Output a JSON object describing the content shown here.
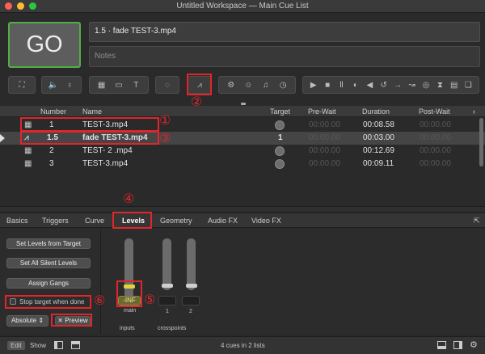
{
  "window": {
    "title": "Untitled Workspace — Main Cue List",
    "colors": {
      "close": "#ff5f57",
      "min": "#febc2e",
      "max": "#28c840"
    }
  },
  "go": {
    "label": "GO"
  },
  "cue_name": "1.5 · fade TEST-3.mp4",
  "notes_placeholder": "Notes",
  "toolbar_icons": [
    "fullscreen-icon",
    "audio-icon",
    "mic-icon",
    "video-icon",
    "camera-icon",
    "text-icon",
    "light-icon",
    "fade-icon",
    "network-icon",
    "midi-icon",
    "music-icon",
    "timecode-icon",
    "start-icon",
    "stop-icon",
    "pause-icon",
    "load-icon",
    "reset-icon",
    "devamp-icon",
    "goto-icon",
    "target-icon",
    "arm-icon",
    "wait-icon",
    "memo-icon",
    "script-icon"
  ],
  "annotations": [
    "①",
    "②",
    "③",
    "④",
    "⑤",
    "⑥"
  ],
  "table": {
    "headers": {
      "number": "Number",
      "name": "Name",
      "target": "Target",
      "prewait": "Pre-Wait",
      "duration": "Duration",
      "postwait": "Post-Wait"
    },
    "rows": [
      {
        "number": "1",
        "name": "TEST-3.mp4",
        "target": "",
        "prewait": "00:00.00",
        "duration": "00:08.58",
        "postwait": "00:00.00",
        "selected": false
      },
      {
        "number": "1.5",
        "name": "fade TEST-3.mp4",
        "target": "1",
        "prewait": "00:00.00",
        "duration": "00:03.00",
        "postwait": "00:00.00",
        "selected": true
      },
      {
        "number": "2",
        "name": "TEST- 2 .mp4",
        "target": "",
        "prewait": "00:00.00",
        "duration": "00:12.69",
        "postwait": "00:00.00",
        "selected": false
      },
      {
        "number": "3",
        "name": "TEST-3.mp4",
        "target": "",
        "prewait": "00:00.00",
        "duration": "00:09.11",
        "postwait": "00:00.00",
        "selected": false
      }
    ]
  },
  "tabs": [
    "Basics",
    "Triggers",
    "Curve",
    "Levels",
    "Geometry",
    "Audio FX",
    "Video FX"
  ],
  "levels": {
    "set_from_target": "Set Levels from Target",
    "set_all_silent": "Set All Silent Levels",
    "assign_gangs": "Assign Gangs",
    "stop_target": "Stop target when done",
    "mode": "Absolute",
    "preview": "✕ Preview",
    "main_value": "-INF",
    "crosspoint_1": "1",
    "crosspoint_2": "2",
    "label_main": "main",
    "label_inputs": "inputs",
    "label_crosspoints": "crosspoints"
  },
  "status": {
    "edit": "Edit",
    "show": "Show",
    "summary": "4 cues in 2 lists"
  }
}
